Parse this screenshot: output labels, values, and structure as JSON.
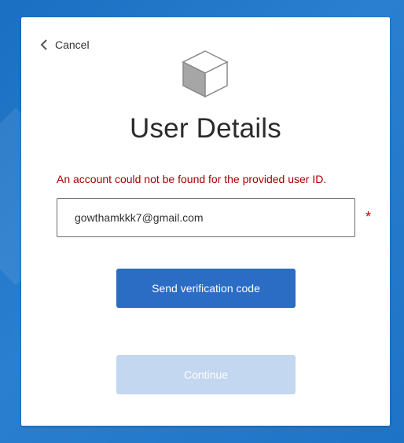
{
  "header": {
    "cancel_label": "Cancel"
  },
  "logo": {
    "icon": "cube-icon"
  },
  "title": "User Details",
  "error_message": "An account could not be found for the provided user ID.",
  "email_field": {
    "value": "gowthamkkk7@gmail.com",
    "required_marker": "*"
  },
  "buttons": {
    "send_code_label": "Send verification code",
    "continue_label": "Continue"
  },
  "colors": {
    "background": "#1e73c6",
    "primary_button": "#2b6cc4",
    "disabled_button": "#c3d7f0",
    "error": "#a80000"
  }
}
